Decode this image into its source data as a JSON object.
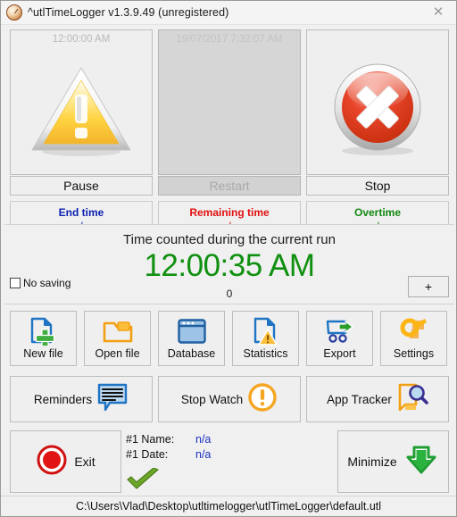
{
  "window": {
    "title": "^utlTimeLogger v1.3.9.49 (unregistered)",
    "icon": "clock-icon",
    "close_label": "✕"
  },
  "top_panels": [
    {
      "id": "pause",
      "time": "12:00:00 AM",
      "label": "Pause",
      "icon": "warning-triangle-icon",
      "disabled": false
    },
    {
      "id": "restart",
      "time": "19/07/2017 7:32:07 AM",
      "label": "Restart",
      "icon": "none",
      "disabled": true
    },
    {
      "id": "stop",
      "time": "",
      "label": "Stop",
      "icon": "red-cross-circle-icon",
      "disabled": false
    }
  ],
  "stats": [
    {
      "id": "end-time",
      "title": "End time",
      "value": "n/a",
      "color": "#0a1fb0"
    },
    {
      "id": "remaining-time",
      "title": "Remaining time",
      "value": "n/a",
      "color": "#e21010"
    },
    {
      "id": "overtime",
      "title": "Overtime",
      "value": "n/a",
      "color": "#11880f"
    }
  ],
  "timer": {
    "caption": "Time counted during the current run",
    "value": "12:00:35 AM",
    "value_color": "#109010",
    "sub_value": "0",
    "no_saving_label": "No saving",
    "no_saving_checked": false,
    "plus_label": "+"
  },
  "toolbar": [
    {
      "id": "new-file",
      "label": "New file",
      "icon": "new-file-icon"
    },
    {
      "id": "open-file",
      "label": "Open file",
      "icon": "open-folder-icon"
    },
    {
      "id": "database",
      "label": "Database",
      "icon": "database-window-icon"
    },
    {
      "id": "statistics",
      "label": "Statistics",
      "icon": "statistics-warning-icon"
    },
    {
      "id": "export",
      "label": "Export",
      "icon": "export-cart-icon"
    },
    {
      "id": "settings",
      "label": "Settings",
      "icon": "settings-key-icon"
    }
  ],
  "wide_buttons": [
    {
      "id": "reminders",
      "label": "Reminders",
      "icon": "speech-bubble-icon"
    },
    {
      "id": "stop-watch",
      "label": "Stop Watch",
      "icon": "orange-exclamation-icon"
    },
    {
      "id": "app-tracker",
      "label": "App Tracker",
      "icon": "document-magnifier-icon"
    }
  ],
  "bottom": {
    "exit_label": "Exit",
    "exit_icon": "red-record-icon",
    "minimize_label": "Minimize",
    "minimize_icon": "green-down-arrow-icon",
    "check_icon": "green-check-icon",
    "info": [
      {
        "key": "#1 Name:",
        "value": "n/a"
      },
      {
        "key": "#1 Date:",
        "value": "n/a"
      }
    ]
  },
  "statusbar": {
    "path": "C:\\Users\\Vlad\\Desktop\\utltimelogger\\utlTimeLogger\\default.utl"
  }
}
